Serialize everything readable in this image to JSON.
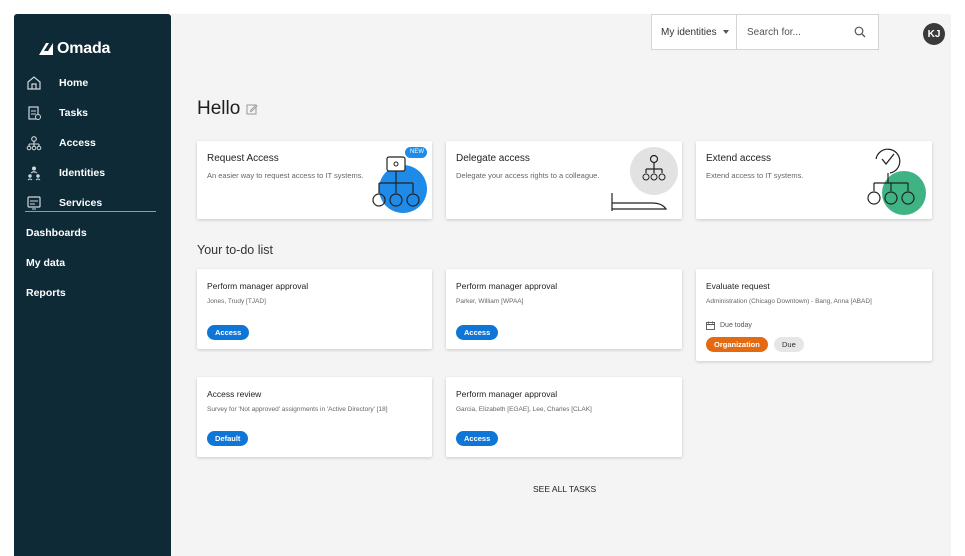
{
  "brand": {
    "name": "Omada"
  },
  "sidebar": {
    "items": [
      {
        "label": "Home",
        "icon": "home-icon"
      },
      {
        "label": "Tasks",
        "icon": "tasks-icon"
      },
      {
        "label": "Access",
        "icon": "access-icon"
      },
      {
        "label": "Identities",
        "icon": "identities-icon"
      },
      {
        "label": "Services",
        "icon": "services-icon"
      }
    ],
    "links": [
      {
        "label": "Dashboards"
      },
      {
        "label": "My data"
      },
      {
        "label": "Reports"
      }
    ]
  },
  "topbar": {
    "identity_select": "My identities",
    "search_placeholder": "Search for...",
    "avatar_initials": "KJ"
  },
  "greeting": "Hello",
  "quick_cards": [
    {
      "title": "Request Access",
      "description": "An easier way to request access to IT systems.",
      "badge": "NEW",
      "accent": "#1e8be8"
    },
    {
      "title": "Delegate access",
      "description": "Delegate your access rights to a colleague.",
      "accent": "#e2e2e2"
    },
    {
      "title": "Extend access",
      "description": "Extend access to IT systems.",
      "accent": "#3fb383"
    }
  ],
  "todo": {
    "title": "Your to-do list",
    "tasks": [
      {
        "title": "Perform manager approval",
        "subtitle": "Jones, Trudy [TJAD]",
        "badge": "Access"
      },
      {
        "title": "Perform manager approval",
        "subtitle": "Parker, William [WPAA]",
        "badge": "Access"
      },
      {
        "title": "Evaluate request",
        "subtitle": "Administration (Chicago Downtown) - Bang, Anna [ABAD]",
        "due": "Due today",
        "badges": [
          "Organization",
          "Due"
        ]
      },
      {
        "title": "Access review",
        "subtitle": "Survey for 'Not approved' assignments in 'Active Directory' [18]",
        "badge": "Default"
      },
      {
        "title": "Perform manager approval",
        "subtitle": "Garcia, Elizabeth [EGAE], Lee, Charles [CLAK]",
        "badge": "Access"
      }
    ],
    "see_all": "SEE ALL TASKS"
  },
  "colors": {
    "sidebar": "#0e2a36",
    "primary": "#0e76d6",
    "orange": "#e46a12"
  }
}
